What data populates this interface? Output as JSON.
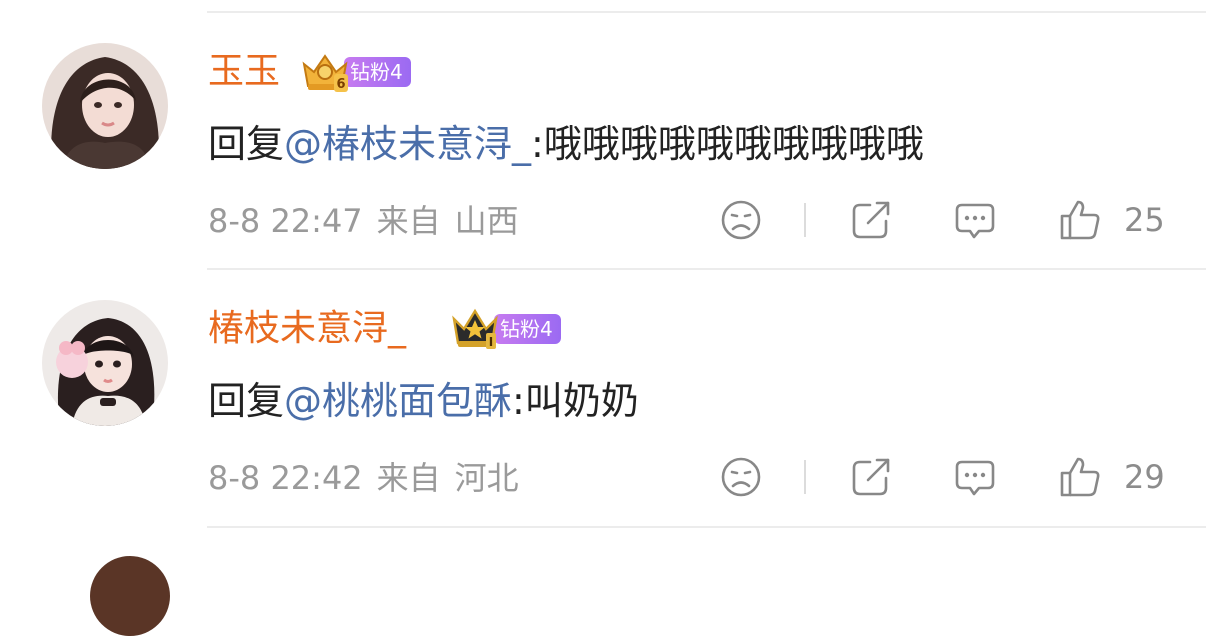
{
  "comments": [
    {
      "username": "玉玉",
      "crown_level": "6",
      "fan_badge": "钻粉4",
      "reply_prefix": "回复",
      "mention": "@椿枝未意浔_",
      "reply_text": ":哦哦哦哦哦哦哦哦哦哦",
      "date": "8-8 22:47",
      "from_label": "来自",
      "location": "山西",
      "like_count": "25"
    },
    {
      "username": "椿枝未意浔_",
      "crown_level": "I",
      "fan_badge": "钻粉4",
      "reply_prefix": "回复",
      "mention": "@桃桃面包酥",
      "reply_text": ":叫奶奶",
      "date": "8-8 22:42",
      "from_label": "来自",
      "location": "河北",
      "like_count": "29"
    }
  ],
  "colors": {
    "username": "#e86a1f",
    "mention": "#4a6ea9",
    "fan_badge": "#a66ff0",
    "meta": "#9a9a9a"
  },
  "icons": [
    "sad-face-icon",
    "share-icon",
    "comment-icon",
    "thumbs-up-icon"
  ]
}
